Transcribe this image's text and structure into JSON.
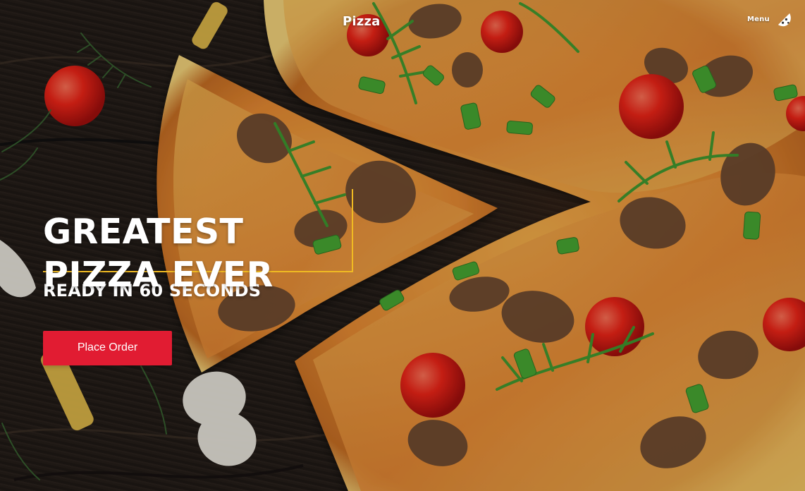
{
  "brand": {
    "name": "Pizza"
  },
  "navigation": {
    "menu_label": "Menu",
    "menu_icon": "pizza-slice-icon"
  },
  "hero": {
    "headline_line_1": "GREATEST",
    "headline_line_2": "PIZZA EVER",
    "subheadline": "READY IN 60 SECONDS",
    "cta_label": "Place Order"
  },
  "colors": {
    "accent": "#F0BA22",
    "cta": "#E11C32",
    "text": "#FFFFFF"
  }
}
